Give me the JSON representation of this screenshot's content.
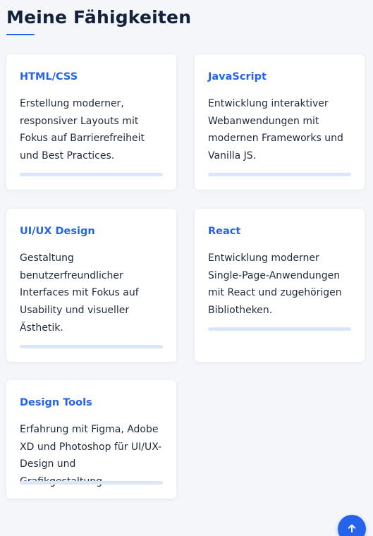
{
  "section": {
    "title": "Meine Fähigkeiten"
  },
  "skills": [
    {
      "title": "HTML/CSS",
      "description": "Erstellung moderner, responsiver Layouts mit Fokus auf Barrierefreiheit und Best Practices.",
      "progress_fraction": 0
    },
    {
      "title": "JavaScript",
      "description": "Entwicklung interaktiver Webanwendungen mit modernen Frameworks und Vanilla JS.",
      "progress_fraction": 0
    },
    {
      "title": "UI/UX Design",
      "description": "Gestaltung benutzerfreundlicher Interfaces mit Fokus auf Usability und visueller Ästhetik.",
      "progress_fraction": 0
    },
    {
      "title": "React",
      "description": "Entwicklung moderner Single-Page-Anwendungen mit React und zugehörigen Bibliotheken.",
      "progress_fraction": 0
    },
    {
      "title": "Design Tools",
      "description": "Erfahrung mit Figma, Adobe XD und Photoshop für UI/UX-Design und Grafikgestaltung.",
      "progress_fraction": 0
    }
  ],
  "scroll_top_button": {
    "icon": "arrow-up-icon"
  },
  "colors": {
    "accent": "#2563eb",
    "title": "#14213d",
    "progress_track": "#dbe7f9",
    "background": "#f4f6fa"
  }
}
